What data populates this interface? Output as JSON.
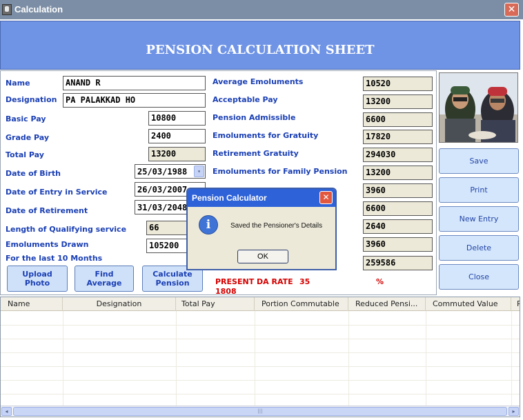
{
  "window": {
    "title": "Calculation",
    "close_glyph": "✕"
  },
  "header": {
    "heading": "PENSION CALCULATION SHEET"
  },
  "form": {
    "name_label": "Name",
    "name_value": "ANAND R",
    "designation_label": "Designation",
    "designation_value": "PA PALAKKAD HO",
    "basic_pay_label": "Basic Pay",
    "basic_pay_value": "10800",
    "grade_pay_label": "Grade Pay",
    "grade_pay_value": "2400",
    "total_pay_label": "Total Pay",
    "total_pay_value": "13200",
    "dob_label": "Date of Birth",
    "dob_value": "25/03/1988",
    "doe_label": "Date of Entry in Service",
    "doe_value": "26/03/2007",
    "dor_label": "Date of Retirement",
    "dor_value": "31/03/2048",
    "qualifying_label": "Length of Qualifying service",
    "qualifying_value": "66",
    "emoluments_drawn_label": "Emoluments Drawn",
    "emoluments_drawn_value": "105200",
    "last10_label": "For the last 10 Months",
    "avg_emoluments_label": "Average Emoluments",
    "avg_emoluments_value": "10520",
    "acceptable_pay_label": "Acceptable Pay",
    "acceptable_pay_value": "13200",
    "pension_admissible_label": "Pension Admissible",
    "pension_admissible_value": "6600",
    "emol_gratuity_label": "Emoluments for Gratuity",
    "emol_gratuity_value": "17820",
    "retirement_gratuity_label": "Retirement Gratuity",
    "retirement_gratuity_value": "294030",
    "emol_family_label": "Emoluments for Family Pension",
    "emol_family_value": "13200",
    "row7_value": "3960",
    "row8_value": "6600",
    "row9_value": "2640",
    "row10_value": "3960",
    "row11_value": "259586",
    "dropdown_glyph": "▾"
  },
  "buttons": {
    "upload_photo": [
      "Upload",
      "Photo"
    ],
    "find_average": [
      "Find",
      "Average"
    ],
    "calculate_pension": [
      "Calculate",
      "Pension"
    ],
    "save": "Save",
    "print": "Print",
    "new_entry": "New Entry",
    "delete": "Delete",
    "close": "Close"
  },
  "da_rate": {
    "label": "PRESENT DA RATE",
    "value": "35",
    "percent": "%",
    "year": "1808"
  },
  "grid": {
    "columns": [
      "Name",
      "Designation",
      "Total Pay",
      "Portion Commutable",
      "Reduced Pensi...",
      "Commuted Value",
      "P"
    ],
    "scroll_left": "◂",
    "scroll_right": "▸",
    "thumb_grip": "|||"
  },
  "dialog": {
    "title": "Pension Calculator",
    "message": "Saved the Pensioner's Details",
    "ok": "OK",
    "close_glyph": "✕",
    "icon_glyph": "i"
  },
  "colors": {
    "banner": "#6f94e6",
    "label_blue": "#1a3fb4",
    "da_red": "#d40000",
    "dialog_title": "#2d62d8"
  }
}
